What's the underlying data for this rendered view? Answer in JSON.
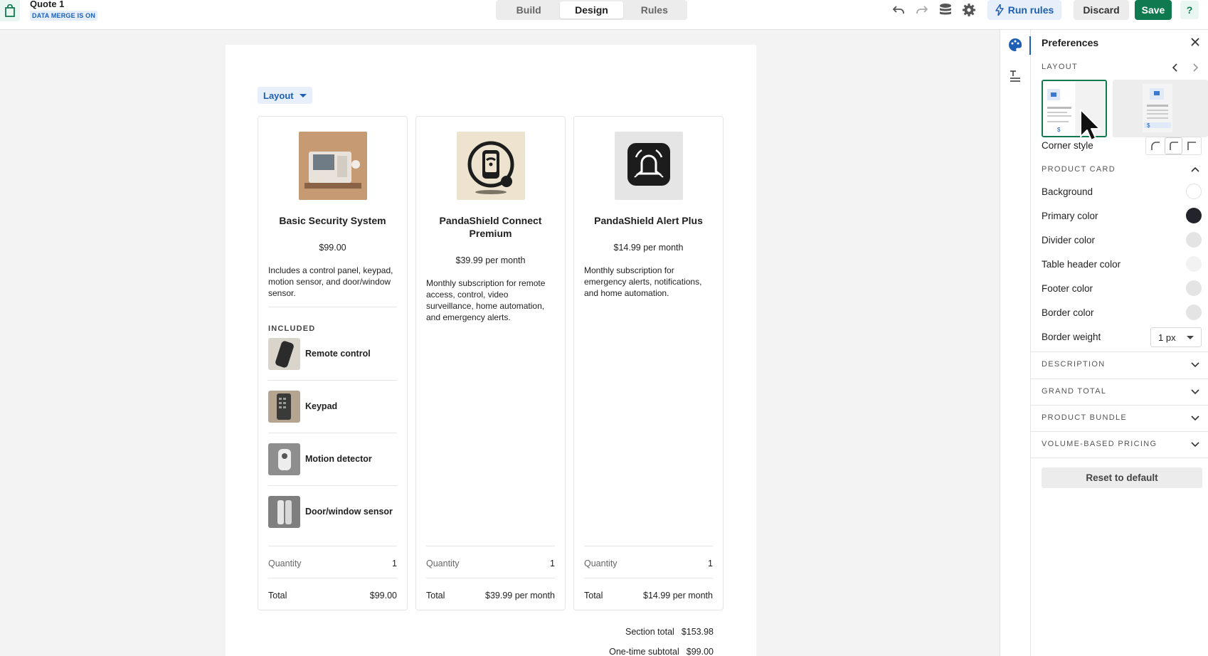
{
  "header": {
    "doc_title": "Quote 1",
    "badge": "DATA MERGE IS ON",
    "tabs": [
      {
        "label": "Build",
        "active": false
      },
      {
        "label": "Design",
        "active": true
      },
      {
        "label": "Rules",
        "active": false
      }
    ],
    "run_rules": "Run rules",
    "discard": "Discard",
    "save": "Save",
    "help": "?",
    "icons": [
      "undo-icon",
      "redo-icon",
      "database-icon",
      "gear-icon"
    ]
  },
  "canvas": {
    "layout_button": "Layout",
    "cards": [
      {
        "name": "Basic Security System",
        "price": "$99.00",
        "description": "Includes a control panel, keypad, motion sensor, and door/window sensor.",
        "included_label": "INCLUDED",
        "included": [
          "Remote control",
          "Keypad",
          "Motion detector",
          "Door/window sensor"
        ],
        "quantity_label": "Quantity",
        "quantity": "1",
        "total_label": "Total",
        "total": "$99.00"
      },
      {
        "name": "PandaShield Connect Premium",
        "price": "$39.99 per month",
        "description": "Monthly subscription for remote access, control, video surveillance, home automation, and emergency alerts.",
        "quantity_label": "Quantity",
        "quantity": "1",
        "total_label": "Total",
        "total": "$39.99 per month"
      },
      {
        "name": "PandaShield Alert Plus",
        "price": "$14.99 per month",
        "description": "Monthly subscription for emergency alerts, notifications, and home automation.",
        "quantity_label": "Quantity",
        "quantity": "1",
        "total_label": "Total",
        "total": "$14.99 per month"
      }
    ],
    "section_total_label": "Section total",
    "section_total": "$153.98",
    "onetime_label": "One-time subtotal",
    "onetime": "$99.00"
  },
  "panel": {
    "title": "Preferences",
    "layout_label": "LAYOUT",
    "corner_style": "Corner style",
    "product_card_label": "PRODUCT CARD",
    "props": [
      {
        "label": "Background",
        "color": "#ffffff"
      },
      {
        "label": "Primary color",
        "color": "#23232b"
      },
      {
        "label": "Divider color",
        "color": "#e4e4e4"
      },
      {
        "label": "Table header color",
        "color": "#f2f2f2"
      },
      {
        "label": "Footer color",
        "color": "#e4e4e4"
      },
      {
        "label": "Border color",
        "color": "#e4e4e4"
      }
    ],
    "border_weight_label": "Border weight",
    "border_weight": "1 px",
    "sections": [
      "DESCRIPTION",
      "GRAND TOTAL",
      "PRODUCT BUNDLE",
      "VOLUME-BASED PRICING"
    ],
    "reset": "Reset to default"
  },
  "colors": {
    "brand_green": "#0f7a4f",
    "accent_blue": "#1e5fb3"
  }
}
